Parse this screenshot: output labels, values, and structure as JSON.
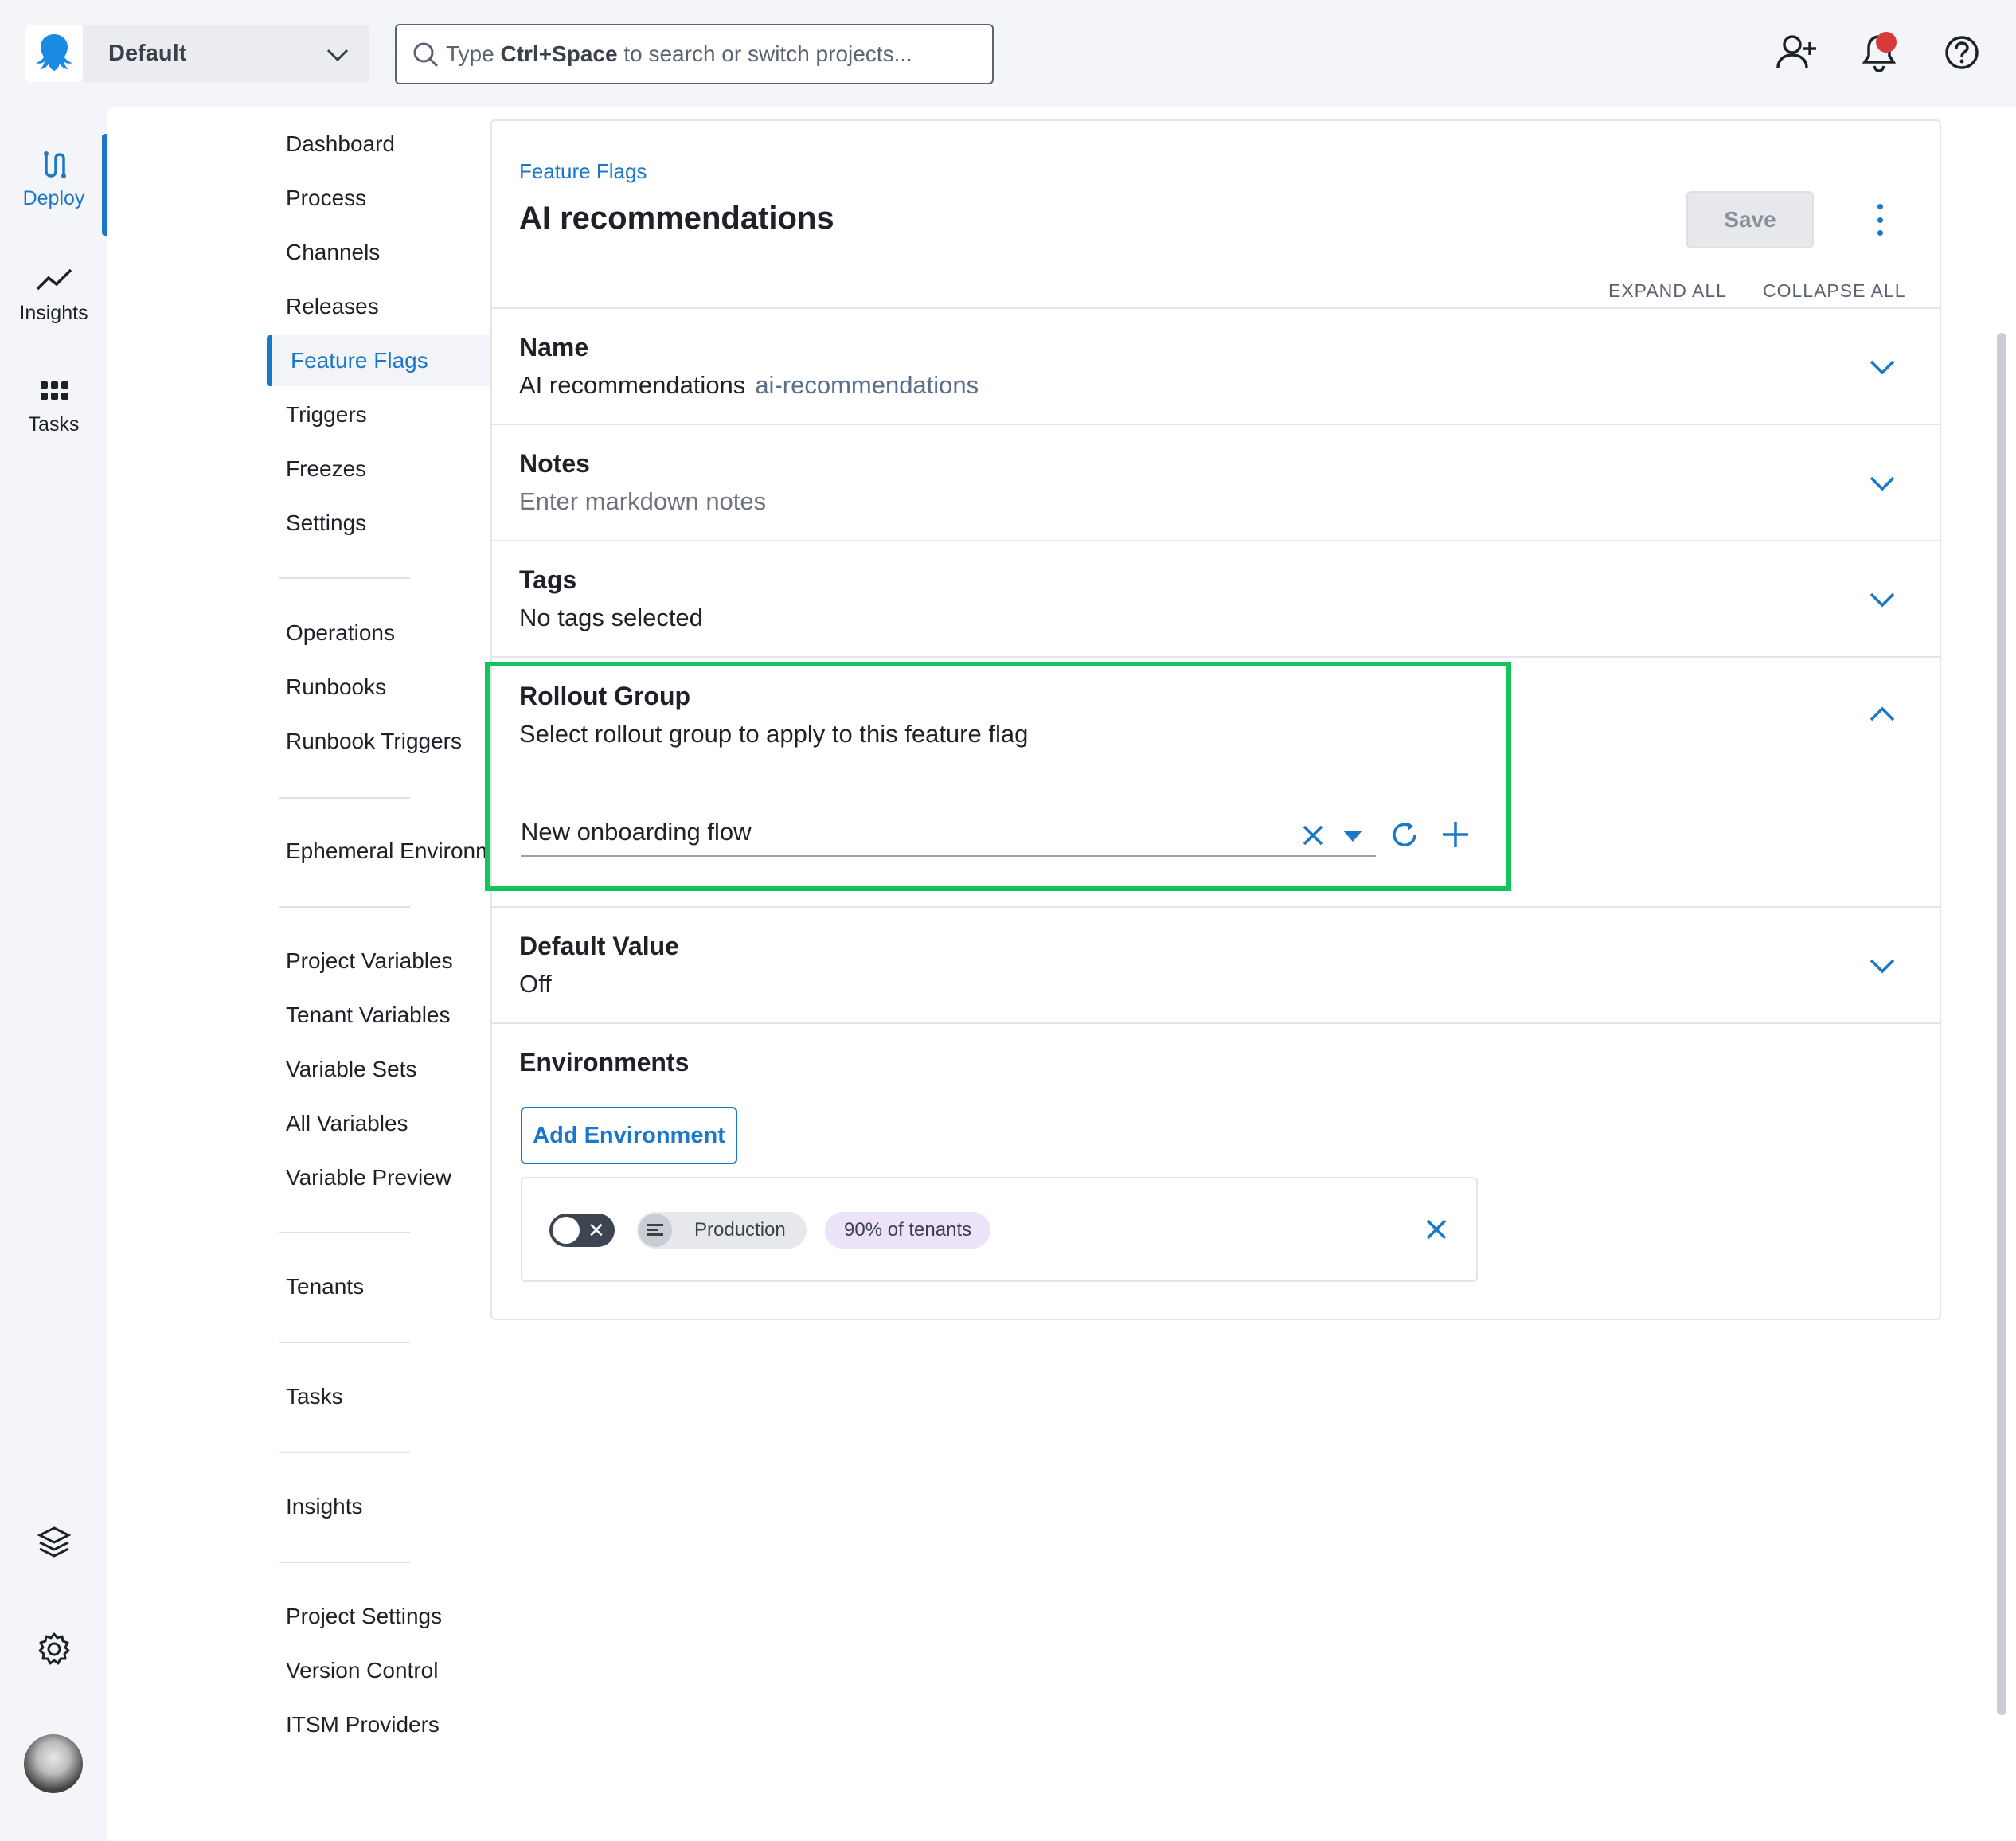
{
  "header": {
    "space_name": "Default",
    "search": {
      "prefix": "Type ",
      "shortcut": "Ctrl+Space",
      "suffix": " to search or switch projects..."
    },
    "icons": [
      "add-user-icon",
      "bell-icon",
      "help-icon"
    ],
    "has_notification": true
  },
  "rail": {
    "items": [
      {
        "label": "Deploy",
        "icon": "deploy-icon",
        "active": true
      },
      {
        "label": "Insights",
        "icon": "insights-icon",
        "active": false
      },
      {
        "label": "Tasks",
        "icon": "tasks-icon",
        "active": false
      }
    ],
    "bottom_icons": [
      "layers-icon",
      "gear-icon",
      "avatar"
    ]
  },
  "subnav": {
    "items": [
      "Dashboard",
      "Process",
      "Channels",
      "Releases",
      "Feature Flags",
      "Triggers",
      "Freezes",
      "Settings",
      "Operations",
      "Runbooks",
      "Runbook Triggers",
      "Ephemeral Environments",
      "Project Variables",
      "Tenant Variables",
      "Variable Sets",
      "All Variables",
      "Variable Preview",
      "Tenants",
      "Tasks",
      "Insights",
      "Project Settings",
      "Version Control",
      "ITSM Providers"
    ],
    "active": "Feature Flags"
  },
  "page": {
    "breadcrumb": "Feature Flags",
    "title": "AI recommendations",
    "save_label": "Save",
    "expand_all": "EXPAND ALL",
    "collapse_all": "COLLAPSE ALL"
  },
  "sections": {
    "name": {
      "title": "Name",
      "value": "AI recommendations",
      "slug": "ai-recommendations"
    },
    "notes": {
      "title": "Notes",
      "placeholder": "Enter markdown notes"
    },
    "tags": {
      "title": "Tags",
      "value": "No tags selected"
    },
    "rollout": {
      "title": "Rollout Group",
      "description": "Select rollout group to apply to this feature flag",
      "selected": "New onboarding flow"
    },
    "default_value": {
      "title": "Default Value",
      "value": "Off"
    },
    "environments": {
      "title": "Environments",
      "add_label": "Add Environment",
      "rows": [
        {
          "enabled": false,
          "environment": "Production",
          "target": "90% of tenants"
        }
      ]
    }
  },
  "colors": {
    "accent": "#1a77ca",
    "highlight": "#13c45b",
    "notification": "#d63a3a",
    "tenant_chip": "#ece3fb"
  }
}
